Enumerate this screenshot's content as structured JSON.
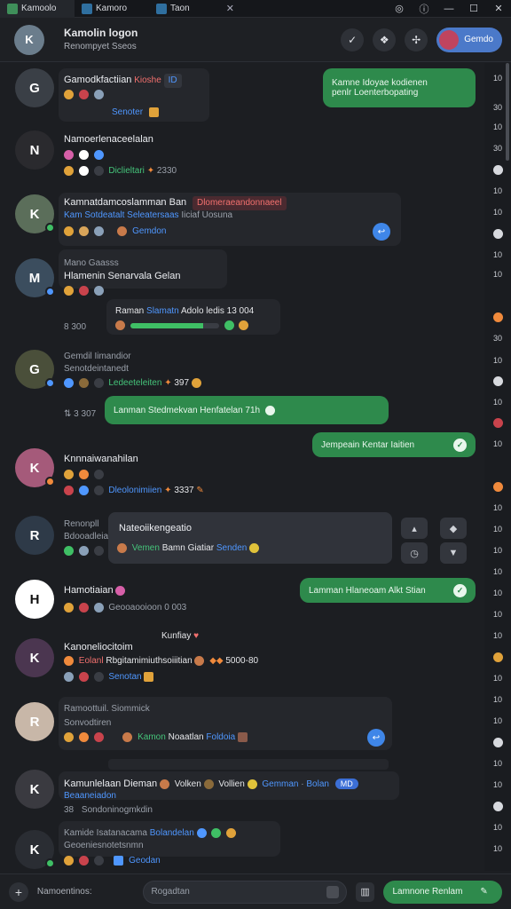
{
  "window": {
    "tabs": [
      {
        "label": "Kamoolo",
        "color": "#3f8f5a"
      },
      {
        "label": "Kamoro",
        "color": "#2f6f9f"
      },
      {
        "label": "Taon",
        "color": "#2f6f9f"
      }
    ],
    "controls": [
      "◎",
      "ⓘ",
      "—",
      "☐",
      "✕"
    ]
  },
  "header": {
    "title": "Kamolin logon",
    "subtitle": "Renompyet Sseos",
    "avatar_color": "#6b7d8c",
    "avatar_initial": "K",
    "icons": [
      "✓",
      "❖",
      "✢"
    ],
    "pill_label": "Gemdo"
  },
  "messages": [
    {
      "name": "Gamodkfactiian",
      "tag1": "Kioshe",
      "tag2": "ID",
      "emojis": [
        "#e0a23a",
        "#c9434c",
        "#8aa0b8"
      ],
      "label": "Senoter",
      "avatar_color": "#3a3f46",
      "initial": "G",
      "bubble": {
        "line1": "Kamne Idoyae kodienen",
        "line2": "penlr Loenterbopating"
      }
    },
    {
      "name": "Namoerlenaceelalan",
      "emojis": [
        "#d65fa8",
        "#ffffff",
        "#4f97ff"
      ],
      "sub": "Diclieltari",
      "num": "2330",
      "avatar_color": "#2a2a2e",
      "initial": "N"
    },
    {
      "name": "Kamnatdamcoslamman Ban",
      "redtag": "Dlomeraeandonnaeel",
      "sub_blue": "Kam Sotdeatalt Seleatersaas",
      "sub_rest": "Iiciaf Uosuna",
      "label": "Gemdon",
      "avatar_color": "#5b6e5a",
      "initial": "K"
    },
    {
      "name": "Mano Gaasss",
      "sub": "Hlamenin Senarvala Gelan",
      "progress_label": "Raman",
      "progress_tag": "Slamatn",
      "progress_text": "Adolo ledis 13 004",
      "progress": 0.82,
      "time": "8 300",
      "avatar_color": "#3b4d5e",
      "initial": "M"
    },
    {
      "name": "Gemdil Iimandior",
      "sub": "Senotdeintanedt",
      "green_line": "Ledeeteleiten",
      "num": "397",
      "time": "3 307",
      "avatar_color": "#4a4f3a",
      "initial": "G",
      "bubble": {
        "line1": "Lanman  Stedmekvan  Henfatelan  71h"
      }
    },
    {
      "name": "Knnnaiwanahilan",
      "sub": "Dleolonimiien",
      "num": "3337",
      "avatar_color": "#a55a7a",
      "initial": "K",
      "bubble": {
        "line1": "Jempeain  Kentar Iaitien"
      }
    },
    {
      "name": "Renonpll",
      "sub": "Bdooadleian",
      "card_title": "Nateoiikengeatio",
      "card_line": "Vemen",
      "card_line2": "Bamn Giatiar",
      "card_tag": "Senden",
      "avatar_color": "#2e3a48",
      "initial": "R"
    },
    {
      "name": "Hamotiaian",
      "sub": "Geooaooioon",
      "time": "0 003",
      "avatar_color": "#ffffff",
      "initial": "H",
      "bubble": {
        "line1": "Lamman  Hlaneoam  Alkt Stian"
      }
    },
    {
      "name": "Kanoneliocitoim",
      "extra": "Kunfiay",
      "sub_red": "Eolanl",
      "sub_rest": "Rbgitamimiuthsoiiitian",
      "num": "5000-80",
      "label": "Senotan",
      "avatar_color": "#4b3650",
      "initial": "K"
    },
    {
      "name": "Ramoottuil. Siommick",
      "sub": "Sonvodtiren",
      "green_line": "Kamon",
      "sub_rest": "Noaatlan",
      "tag": "Foldoia",
      "avatar_color": "#c8b7a8",
      "initial": "R"
    },
    {
      "name": "Kamunlelaan Dieman",
      "name_tail": "Volken",
      "name_tail2": "Vollien",
      "blue_tail": "Gemman",
      "tail2": "Bolan",
      "badge": "MD",
      "sub_blue": "Beaaneiadon",
      "time": "38",
      "sub": "Sondoninogmkdin",
      "avatar_color": "#3a3a40",
      "initial": "K"
    },
    {
      "name": "Kamide Isatanacama",
      "blue_tail": "Bolandelan",
      "sub": "Geoeniesnotetsnmn",
      "label": "Geodan",
      "avatar_color": "#2a2d33",
      "initial": "K"
    }
  ],
  "rail": [
    "10",
    "30",
    "10",
    "30",
    "10",
    "10",
    "10",
    "10",
    "30",
    "10",
    "10",
    "10",
    "10",
    "10",
    "10",
    "10",
    "10",
    "10",
    "10",
    "10",
    "10",
    "10",
    "10",
    "10",
    "10",
    "10"
  ],
  "composer": {
    "label": "Namoentinos:",
    "search_placeholder": "Rogadtan",
    "send_label": "Lamnone Renlam"
  }
}
